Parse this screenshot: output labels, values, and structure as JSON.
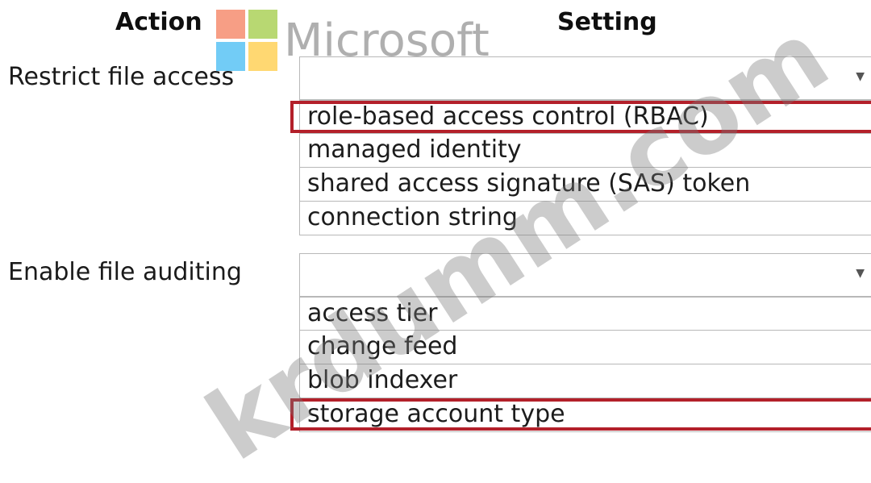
{
  "headers": {
    "action": "Action",
    "setting": "Setting"
  },
  "watermark": {
    "brand_text": "Microsoft",
    "site_text": "krdumm.com",
    "logo_colors": [
      "#f25022",
      "#7fba00",
      "#00a4ef",
      "#ffb900"
    ]
  },
  "rows": [
    {
      "action": "Restrict file access",
      "dropdown_value": "",
      "options": [
        "role-based access control (RBAC)",
        "managed identity",
        "shared access signature (SAS) token",
        "connection string"
      ],
      "selected_option": "role-based access control (RBAC)"
    },
    {
      "action": "Enable file auditing",
      "dropdown_value": "",
      "options": [
        "access tier",
        "change feed",
        "blob indexer",
        "storage account type"
      ],
      "selected_option": "storage account type"
    }
  ],
  "colors": {
    "selection_border": "#b3202a",
    "option_border": "#b8b8b8"
  }
}
